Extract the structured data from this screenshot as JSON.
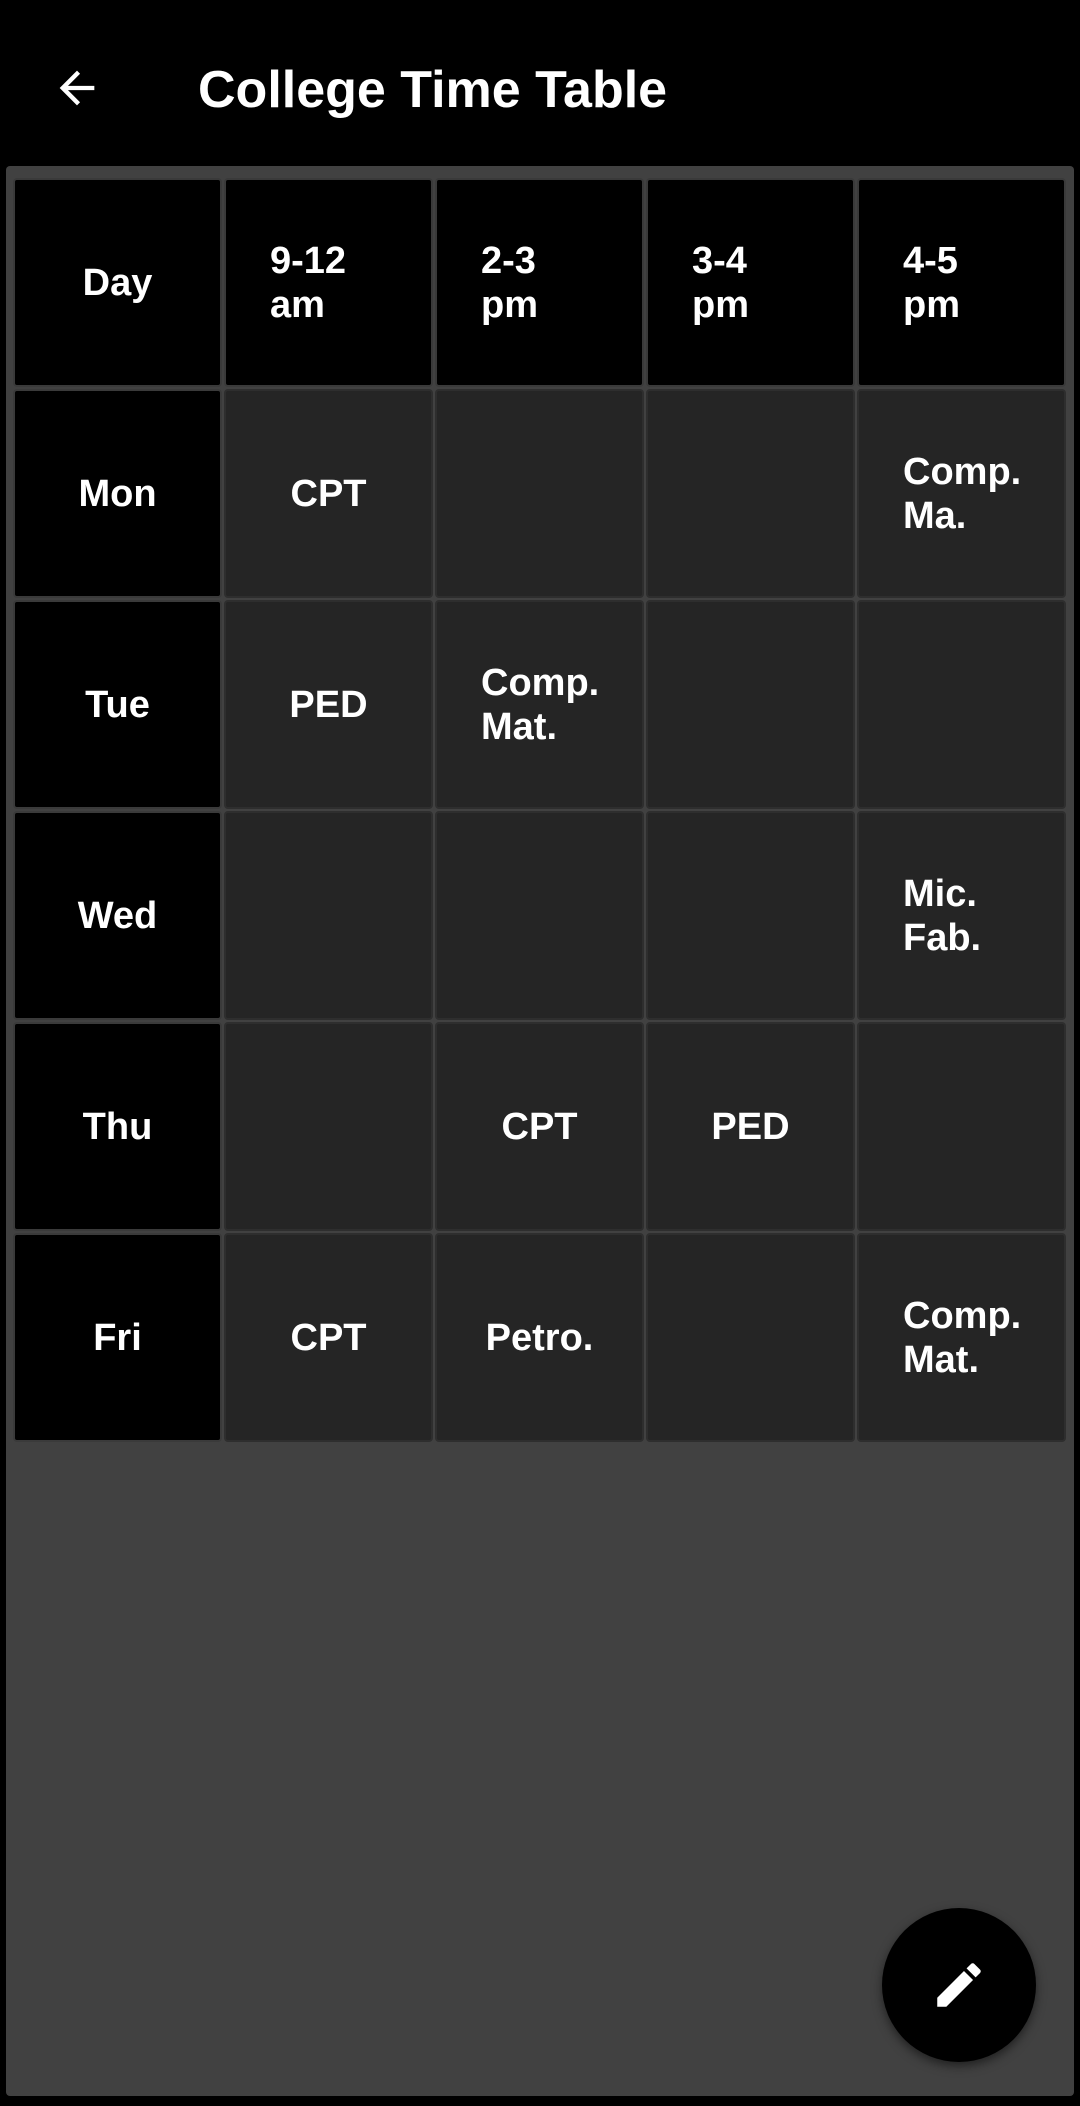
{
  "app_bar": {
    "title": "College Time Table",
    "back_icon": "arrow-back-icon"
  },
  "timetable": {
    "header": [
      "Day",
      "9-12\nam",
      "2-3\npm",
      "3-4\npm",
      "4-5\npm"
    ],
    "rows": [
      {
        "day": "Mon",
        "slots": [
          "CPT",
          "",
          "",
          "Comp.\nMa."
        ]
      },
      {
        "day": "Tue",
        "slots": [
          "PED",
          "Comp.\nMat.",
          "",
          ""
        ]
      },
      {
        "day": "Wed",
        "slots": [
          "",
          "",
          "",
          "Mic.\nFab."
        ]
      },
      {
        "day": "Thu",
        "slots": [
          "",
          "CPT",
          "PED",
          ""
        ]
      },
      {
        "day": "Fri",
        "slots": [
          "CPT",
          "Petro.",
          "",
          "Comp.\nMat."
        ]
      }
    ]
  },
  "fab": {
    "icon": "pencil-icon"
  },
  "colors": {
    "background": "#000000",
    "content": "#414141",
    "cell": "#252525",
    "header_cell": "#000000",
    "text": "#ffffff"
  }
}
